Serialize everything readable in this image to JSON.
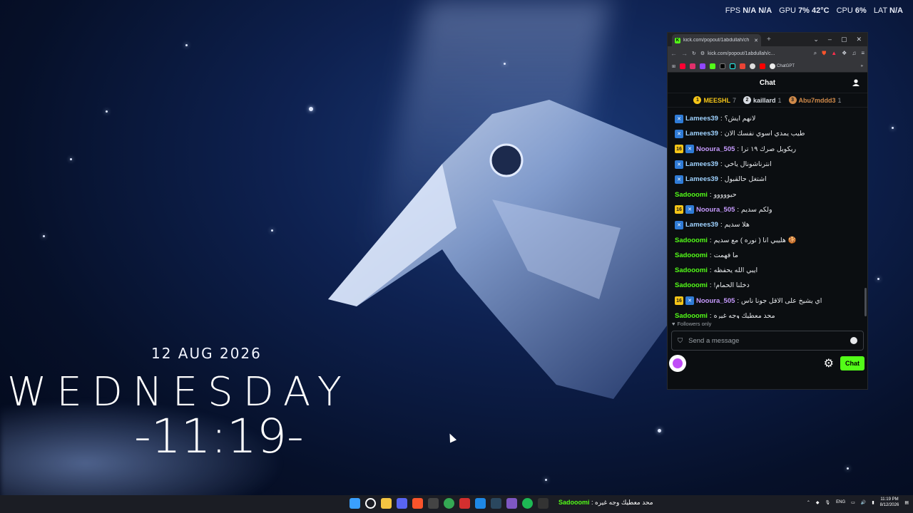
{
  "perf": {
    "fps_label": "FPS",
    "fps_value": "N/A",
    "fps_value2": "N/A",
    "gpu_label": "GPU",
    "gpu_value": "7%  42°C",
    "cpu_label": "CPU",
    "cpu_value": "6%",
    "lat_label": "LAT",
    "lat_value": "N/A"
  },
  "clock": {
    "date": "12 AUG 2026",
    "day": "WEDNESDAY",
    "time": "-11:19-"
  },
  "browser": {
    "tab_title": "kick.com/popout/1abdullah/ch",
    "url": "kick.com/popout/1abdullah/c...",
    "bookmark_label": "ChatGPT"
  },
  "chat": {
    "title": "Chat",
    "leaderboard": [
      {
        "rank": "1",
        "name": "MEESHL",
        "count": "7",
        "color": "#f5c518"
      },
      {
        "rank": "2",
        "name": "kaillard",
        "count": "1",
        "color": "#d9dde3"
      },
      {
        "rank": "3",
        "name": "Abu7mddd3",
        "count": "1",
        "color": "#d08a4a"
      }
    ],
    "messages": [
      {
        "user": "Lamees39",
        "text": "لانهم ايش؟",
        "badges": [
          "verified"
        ],
        "color": "#9fd2ff"
      },
      {
        "user": "Lamees39",
        "text": "طيب يمدي اسوي نفسك الان",
        "badges": [
          "verified"
        ],
        "color": "#9fd2ff"
      },
      {
        "user": "Nooura_505",
        "text": "ريكويل صرك ١٩ ترا",
        "badges": [
          "sub16",
          "verified"
        ],
        "color": "#c79bff"
      },
      {
        "user": "Lamees39",
        "text": "انترناشونال ياخي",
        "badges": [
          "verified"
        ],
        "color": "#9fd2ff"
      },
      {
        "user": "Lamees39",
        "text": "اشتغل حالقبول",
        "badges": [
          "verified"
        ],
        "color": "#9fd2ff"
      },
      {
        "user": "Sadooomi",
        "text": "حيووووو",
        "badges": [],
        "color": "#53fc18"
      },
      {
        "user": "Nooura_505",
        "text": "ولكم سديم",
        "badges": [
          "sub16",
          "verified"
        ],
        "color": "#c79bff"
      },
      {
        "user": "Lamees39",
        "text": "هلا سديم",
        "badges": [
          "verified"
        ],
        "color": "#9fd2ff"
      },
      {
        "user": "Sadooomi",
        "text": "هليبي انا ( نوره ) مع سديم 🍪",
        "badges": [],
        "color": "#53fc18"
      },
      {
        "user": "Sadooomi",
        "text": "ما فهمت",
        "badges": [],
        "color": "#53fc18"
      },
      {
        "user": "Sadooomi",
        "text": "ايبي الله يحفظه",
        "badges": [],
        "color": "#53fc18"
      },
      {
        "user": "Sadooomi",
        "text": "!دخلنا الحمام",
        "badges": [],
        "color": "#53fc18"
      },
      {
        "user": "Nooura_505",
        "text": "اي يشيخ على الاقل جونا ناس",
        "badges": [
          "sub16",
          "verified"
        ],
        "color": "#c79bff"
      },
      {
        "user": "Sadooomi",
        "text": "محد معطيك وجه غيره",
        "badges": [],
        "color": "#53fc18"
      }
    ],
    "sub_badge_text": "16",
    "followers_only": "Followers only",
    "input_placeholder": "Send a message",
    "send_label": "Chat"
  },
  "taskbar": {
    "chat_user": "Sadooomi",
    "chat_text": ": محد معطيك وجه غيره",
    "lang": "ENG",
    "time": "11:19 PM",
    "date": "8/12/2026"
  }
}
